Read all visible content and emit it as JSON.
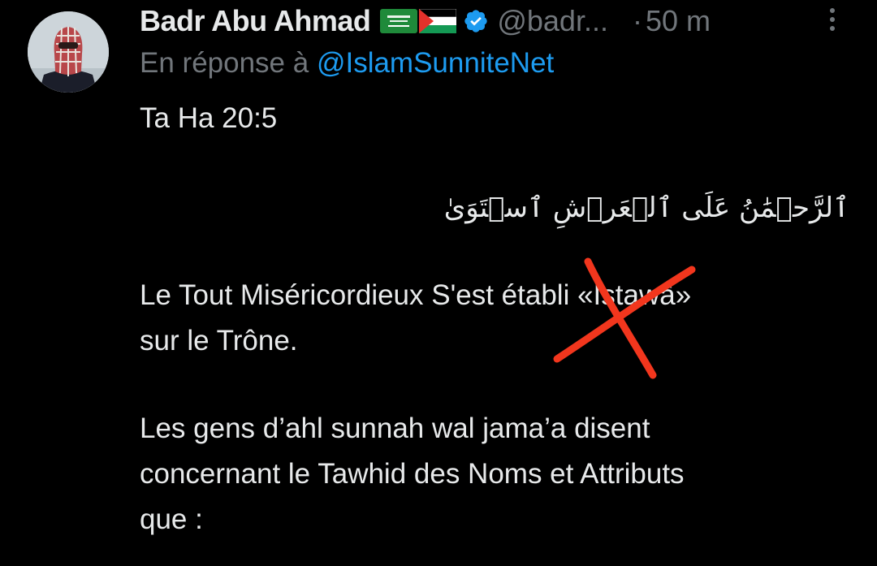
{
  "tweet": {
    "display_name": "Badr Abu Ahmad",
    "flags": [
      "saudi-arabia-flag",
      "palestine-flag"
    ],
    "verified": true,
    "handle": "@badr...",
    "separator": "·",
    "time": "50 m",
    "reply_prefix": "En réponse à ",
    "reply_to": "@IslamSunniteNet",
    "lines": [
      "Ta Ha 20:5",
      "ٱلرَّحۡمَٰنُ عَلَى ٱلۡعَرۡشِ ٱسۡتَوَىٰ",
      "Le Tout Miséricordieux S'est établi «Istawâ»",
      "sur le Trône.",
      "Les gens d’ahl sunnah wal jama’a disent",
      "concernant le Tawhid des Noms et Attributs",
      "que :"
    ]
  },
  "colors": {
    "background": "#000000",
    "text_primary": "#e7e9ea",
    "text_secondary": "#71767b",
    "link": "#1d9bf0",
    "verified_badge": "#1d9bf0",
    "annotation_cross": "#f2361d"
  },
  "icons": {
    "more": "more-vertical-icon",
    "verified": "verified-badge-icon",
    "annotation": "red-x-mark"
  }
}
